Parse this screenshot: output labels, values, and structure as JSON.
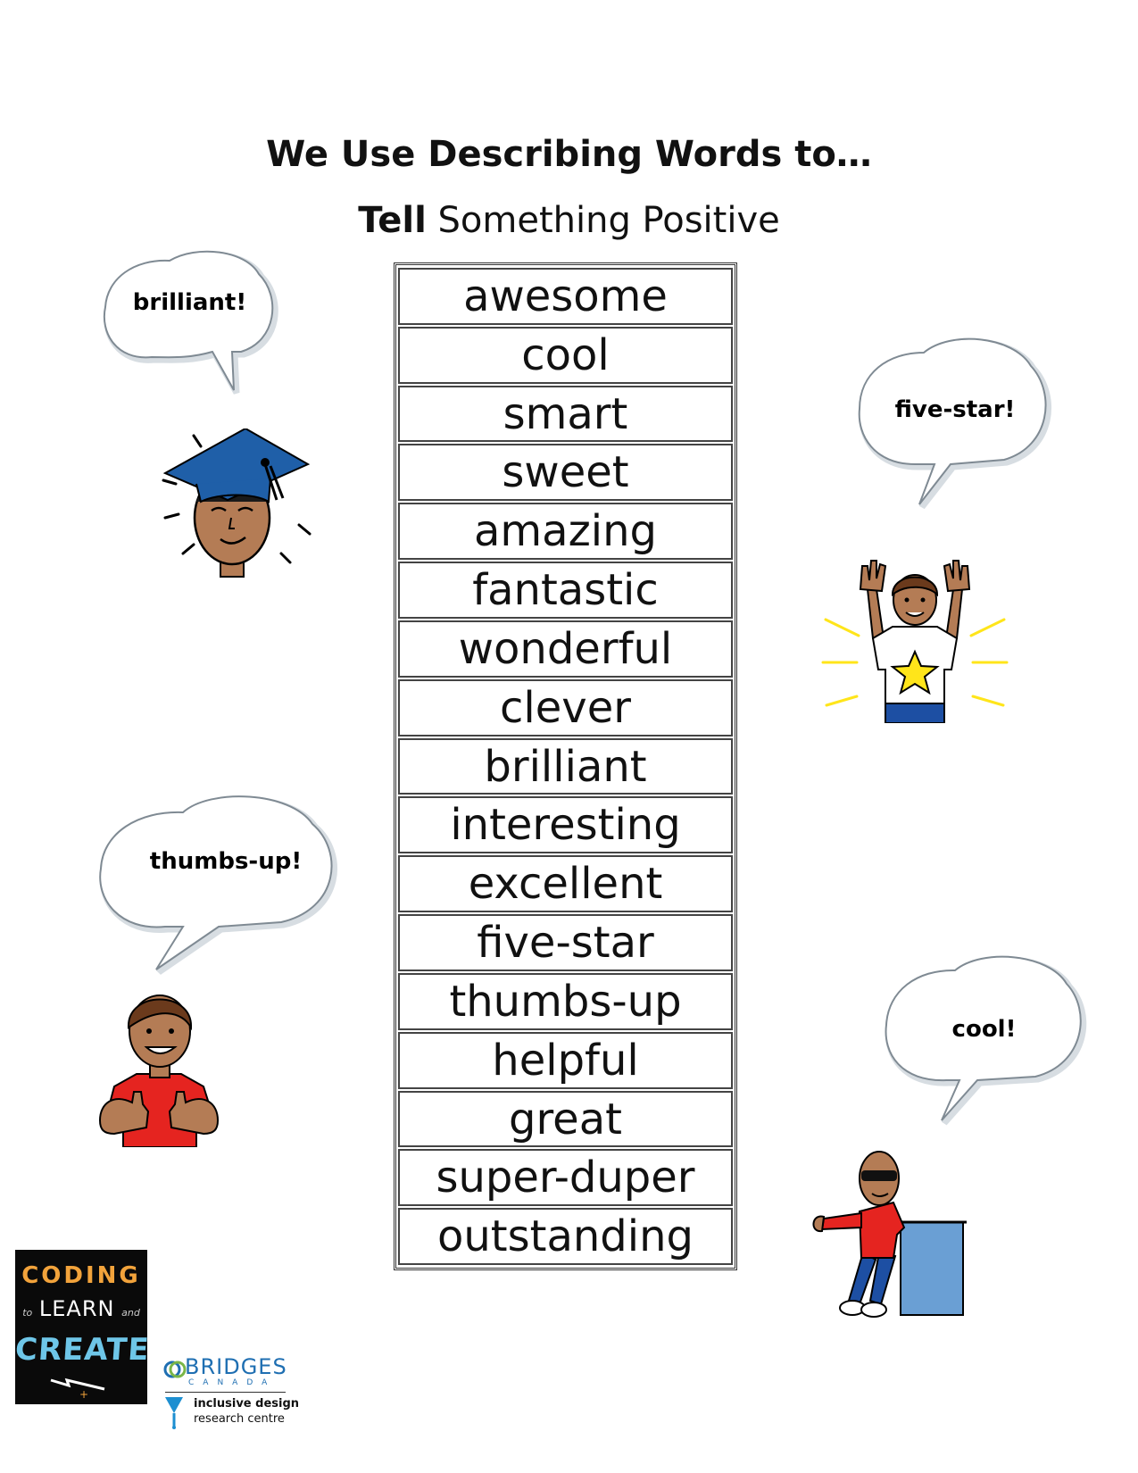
{
  "title": "We Use Describing Words to…",
  "subtitle": {
    "bold": "Tell",
    "rest": "Something Positive"
  },
  "words": [
    "awesome",
    "cool",
    "smart",
    "sweet",
    "amazing",
    "fantastic",
    "wonderful",
    "clever",
    "brilliant",
    "interesting",
    "excellent",
    "five-star",
    "thumbs-up",
    "helpful",
    "great",
    "super-duper",
    "outstanding"
  ],
  "bubbles": {
    "brilliant": "brilliant!",
    "five_star": "five-star!",
    "thumbs_up": "thumbs-up!",
    "cool": "cool!"
  },
  "logos": {
    "coding": {
      "line1": "CODING",
      "line2_small1": "to",
      "line2": "LEARN",
      "line2_small2": "and",
      "line3": "CREATE"
    },
    "bridges": {
      "name": "BRIDGES",
      "sub": "CANADA"
    },
    "idrc": {
      "line1": "inclusive design",
      "line2": "research centre"
    }
  },
  "colors": {
    "cap": "#1f5fa8",
    "shirt_red": "#e52420",
    "jeans": "#1d4fa3",
    "desk": "#6a9fd4",
    "star": "#ffe51a",
    "skin": "#b47c55",
    "hair": "#6b3a1c",
    "bubble_stroke": "#9aa4ad",
    "bubble_shadow": "#d7dde2"
  }
}
